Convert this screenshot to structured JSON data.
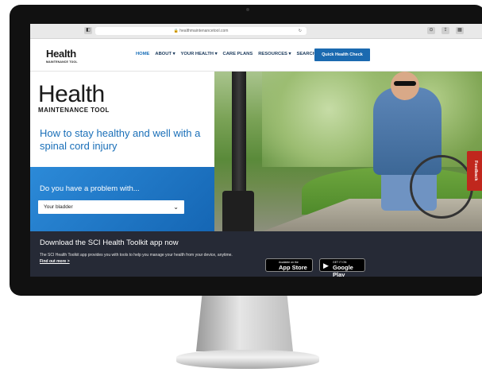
{
  "browser": {
    "url": "healthmaintenancetool.com",
    "reload_icon": "↻"
  },
  "logo": {
    "word": "Health",
    "subtitle": "MAINTENANCE TOOL"
  },
  "nav": {
    "items": [
      "HOME",
      "ABOUT ▾",
      "YOUR HEALTH ▾",
      "CARE PLANS",
      "RESOURCES ▾",
      "SEARCH"
    ],
    "cta_label": "Quick Health Check"
  },
  "hero": {
    "logo_word": "Health",
    "logo_subtitle": "MAINTENANCE TOOL",
    "tagline": "How to stay healthy and well with a spinal cord injury"
  },
  "problem": {
    "title": "Do you have a problem with...",
    "selected": "Your bladder"
  },
  "feedback_label": "Feedback",
  "download": {
    "title": "Download the SCI Health Toolkit app now",
    "text": "The SCI Health Toolkit app provides you with tools to help you manage your health from your device, anytime.",
    "link": "Find out more >",
    "appstore_small": "Available on the",
    "appstore_big": "App Store",
    "googleplay_small": "GET IT ON",
    "googleplay_big": "Google Play"
  },
  "colors": {
    "brand_blue": "#1a6fb8",
    "feedback_red": "#c0271d",
    "dark_band": "#262a36"
  }
}
